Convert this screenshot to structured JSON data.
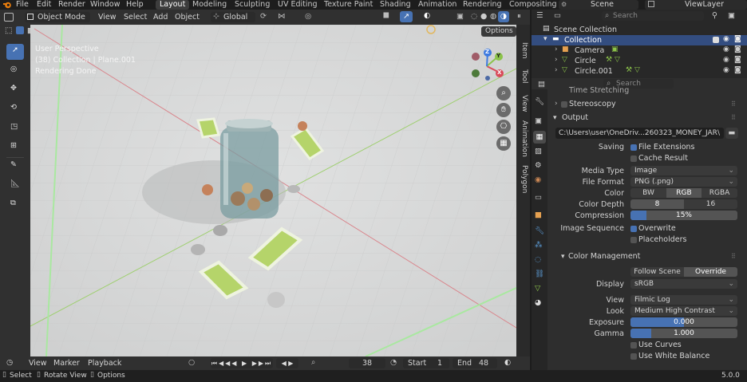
{
  "menu": [
    "File",
    "Edit",
    "Render",
    "Window",
    "Help"
  ],
  "workspaces": [
    "Layout",
    "Modeling",
    "Sculpting",
    "UV Editing",
    "Texture Paint",
    "Shading",
    "Animation",
    "Rendering",
    "Compositing"
  ],
  "active_workspace": "Layout",
  "scene_name": "Scene",
  "view_layer": "ViewLayer",
  "header": {
    "mode": "Object Mode",
    "menus": [
      "View",
      "Select",
      "Add",
      "Object"
    ],
    "transform_orientation": "Global",
    "options_label": "Options"
  },
  "viewport": {
    "overlay_line1": "User Perspective",
    "overlay_line2": "(38) Collection | Plane.001",
    "overlay_line3": "Rendering Done",
    "gizmo_axes": [
      "X",
      "Y",
      "Z"
    ]
  },
  "side_tabs": [
    "Item",
    "Tool",
    "View",
    "Animation",
    "Polygon"
  ],
  "outliner": {
    "search_placeholder": "Search",
    "root": "Scene Collection",
    "collection": "Collection",
    "items": [
      "Camera",
      "Circle",
      "Circle.001"
    ]
  },
  "properties": {
    "search_placeholder": "Search",
    "time_stretching": "Time Stretching",
    "stereoscopy": "Stereoscopy",
    "output_header": "Output",
    "output_path": "C:\\Users\\user\\OneDriv...260323_MONEY_JAR\\",
    "saving_label": "Saving",
    "file_extensions": "File Extensions",
    "cache_result": "Cache Result",
    "media_type_label": "Media Type",
    "media_type": "Image",
    "file_format_label": "File Format",
    "file_format": "PNG (.png)",
    "color_label": "Color",
    "color_options": [
      "BW",
      "RGB",
      "RGBA"
    ],
    "color_selected": "RGB",
    "color_depth_label": "Color Depth",
    "color_depth_options": [
      "8",
      "16"
    ],
    "color_depth_selected": "8",
    "compression_label": "Compression",
    "compression_value": "15%",
    "compression_fraction": 0.15,
    "image_sequence_label": "Image Sequence",
    "overwrite": "Overwrite",
    "placeholders": "Placeholders",
    "color_mgmt_header": "Color Management",
    "cm_options": [
      "Follow Scene",
      "Override"
    ],
    "cm_selected": "Override",
    "display_label": "Display",
    "display_value": "sRGB",
    "view_label": "View",
    "view_value": "Filmic Log",
    "look_label": "Look",
    "look_value": "Medium High Contrast",
    "exposure_label": "Exposure",
    "exposure_value": "0.000",
    "gamma_label": "Gamma",
    "gamma_value": "1.000",
    "use_curves": "Use Curves",
    "use_white_balance": "Use White Balance"
  },
  "timeline": {
    "menus": [
      "View",
      "Marker",
      "Playback"
    ],
    "current_frame": "38",
    "start_label": "Start",
    "start_value": "1",
    "end_label": "End",
    "end_value": "48"
  },
  "status": {
    "select": "Select",
    "rotate": "Rotate View",
    "options": "Options",
    "version": "5.0.0"
  },
  "colors": {
    "accent": "#4772b3",
    "x_axis": "#d94a5a",
    "y_axis": "#8bc34a",
    "z_axis": "#3d7ae0"
  }
}
